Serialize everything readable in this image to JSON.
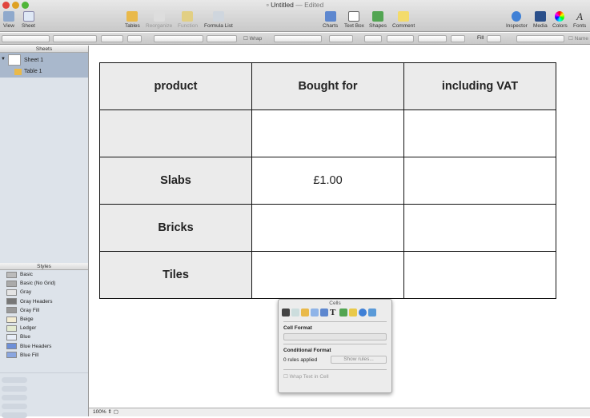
{
  "window": {
    "title": "Untitled",
    "status": "— Edited"
  },
  "toolbar": {
    "left": [
      {
        "label": "View",
        "icon": "view-icon"
      },
      {
        "label": "Sheet",
        "icon": "sheet-icon"
      }
    ],
    "middle": [
      {
        "label": "Tables",
        "icon": "tables-icon",
        "enabled": true
      },
      {
        "label": "Reorganize",
        "icon": "reorganize-icon",
        "enabled": false
      },
      {
        "label": "Function",
        "icon": "function-icon",
        "enabled": false
      },
      {
        "label": "Formula List",
        "icon": "formula-list-icon",
        "enabled": true
      }
    ],
    "insert": [
      {
        "label": "Charts",
        "icon": "charts-icon"
      },
      {
        "label": "Text Box",
        "icon": "text-box-icon"
      },
      {
        "label": "Shapes",
        "icon": "shapes-icon"
      },
      {
        "label": "Comment",
        "icon": "comment-icon"
      }
    ],
    "right": [
      {
        "label": "Inspector",
        "icon": "inspector-icon"
      },
      {
        "label": "Media",
        "icon": "media-icon"
      },
      {
        "label": "Colors",
        "icon": "colors-icon"
      },
      {
        "label": "Fonts",
        "icon": "fonts-icon"
      }
    ]
  },
  "format_bar": {
    "wrap_label": "Wrap",
    "fill_label": "Fill",
    "name_label": "Name"
  },
  "sheets": {
    "header": "Sheets",
    "sheet": "Sheet 1",
    "table": "Table 1"
  },
  "styles": {
    "header": "Styles",
    "items": [
      {
        "label": "Basic",
        "color": "#bbbbbb"
      },
      {
        "label": "Basic (No Grid)",
        "color": "#aaaaaa"
      },
      {
        "label": "Gray",
        "color": "#e4e4e4"
      },
      {
        "label": "Gray Headers",
        "color": "#777777"
      },
      {
        "label": "Gray Fill",
        "color": "#999999"
      },
      {
        "label": "Beige",
        "color": "#f3ecd2"
      },
      {
        "label": "Ledger",
        "color": "#e3ead0"
      },
      {
        "label": "Blue",
        "color": "#e8eef8"
      },
      {
        "label": "Blue Headers",
        "color": "#6d8fd8"
      },
      {
        "label": "Blue Fill",
        "color": "#8aa6e0"
      }
    ]
  },
  "table": {
    "headers": [
      "product",
      "Bought for",
      "including VAT"
    ],
    "rows": [
      [
        "",
        "",
        ""
      ],
      [
        "Slabs",
        "£1.00",
        ""
      ],
      [
        "Bricks",
        "",
        ""
      ],
      [
        "Tiles",
        "",
        ""
      ]
    ]
  },
  "statusbar": {
    "zoom": "100%"
  },
  "inspector": {
    "title": "Cells",
    "cell_format_label": "Cell Format",
    "conditional_format_label": "Conditional Format",
    "rules_applied": "0 rules applied",
    "show_rules_button": "Show rules...",
    "wrap_text_label": "Wrap Text in Cell"
  }
}
